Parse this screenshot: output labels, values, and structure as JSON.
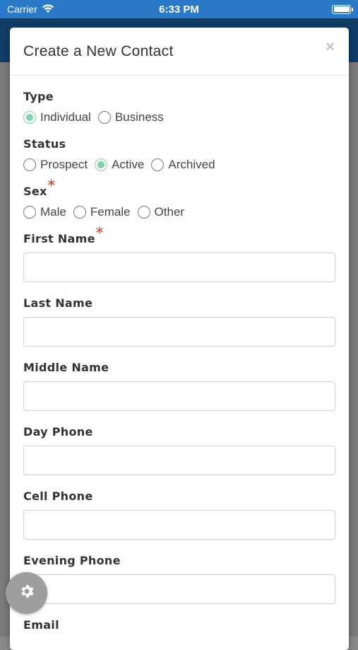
{
  "status_bar": {
    "carrier": "Carrier",
    "time": "6:33 PM"
  },
  "modal": {
    "title": "Create a New Contact",
    "close_label": "×"
  },
  "form": {
    "type": {
      "label": "Type",
      "options": [
        "Individual",
        "Business"
      ],
      "selected": "Individual"
    },
    "status": {
      "label": "Status",
      "options": [
        "Prospect",
        "Active",
        "Archived"
      ],
      "selected": "Active"
    },
    "sex": {
      "label": "Sex",
      "required_mark": "*",
      "options": [
        "Male",
        "Female",
        "Other"
      ],
      "selected": ""
    },
    "first_name": {
      "label": "First Name",
      "required_mark": "*",
      "value": ""
    },
    "last_name": {
      "label": "Last Name",
      "value": ""
    },
    "middle_name": {
      "label": "Middle Name",
      "value": ""
    },
    "day_phone": {
      "label": "Day Phone",
      "value": ""
    },
    "cell_phone": {
      "label": "Cell Phone",
      "value": ""
    },
    "evening_phone": {
      "label": "Evening Phone",
      "value": ""
    },
    "email": {
      "label": "Email",
      "value": ""
    }
  },
  "colors": {
    "accent_radio": "#7fd3a6",
    "status_bar": "#2a79c9",
    "required": "#c0392b"
  },
  "icons": {
    "wifi": "wifi-icon",
    "battery": "battery-icon",
    "settings": "gear-icon"
  }
}
